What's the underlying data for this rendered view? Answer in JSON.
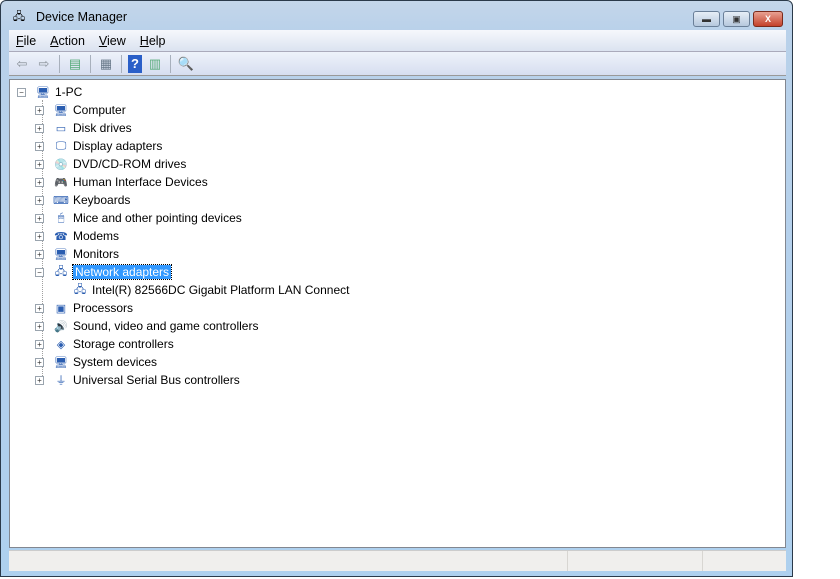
{
  "window": {
    "title": "Device Manager",
    "minimize": "—",
    "maximize": "□",
    "close": "X"
  },
  "menu": [
    {
      "label": "File",
      "key": "F",
      "rest": "ile"
    },
    {
      "label": "Action",
      "key": "A",
      "rest": "ction"
    },
    {
      "label": "View",
      "key": "V",
      "rest": "iew"
    },
    {
      "label": "Help",
      "key": "H",
      "rest": "elp"
    }
  ],
  "toolbar": [
    "back",
    "forward",
    "show-hide-console-tree",
    "properties",
    "help",
    "show-action-pane",
    "scan-hardware"
  ],
  "tree": {
    "root": "1-PC",
    "items": [
      {
        "label": "Computer",
        "icon": "computer-icon"
      },
      {
        "label": "Disk drives",
        "icon": "disk-icon"
      },
      {
        "label": "Display adapters",
        "icon": "display-icon"
      },
      {
        "label": "DVD/CD-ROM drives",
        "icon": "dvd-icon"
      },
      {
        "label": "Human Interface Devices",
        "icon": "hid-icon"
      },
      {
        "label": "Keyboards",
        "icon": "keyboard-icon"
      },
      {
        "label": "Mice and other pointing devices",
        "icon": "mouse-icon"
      },
      {
        "label": "Modems",
        "icon": "modem-icon"
      },
      {
        "label": "Monitors",
        "icon": "monitor-icon"
      },
      {
        "label": "Network adapters",
        "icon": "network-icon",
        "expanded": true,
        "selected": true,
        "children": [
          "Intel(R) 82566DC Gigabit Platform LAN Connect"
        ]
      },
      {
        "label": "Processors",
        "icon": "processor-icon"
      },
      {
        "label": "Sound, video and game controllers",
        "icon": "sound-icon"
      },
      {
        "label": "Storage controllers",
        "icon": "storage-icon"
      },
      {
        "label": "System devices",
        "icon": "system-icon"
      },
      {
        "label": "Universal Serial Bus controllers",
        "icon": "usb-icon"
      }
    ]
  },
  "colors": {
    "selection": "#3399ff"
  }
}
